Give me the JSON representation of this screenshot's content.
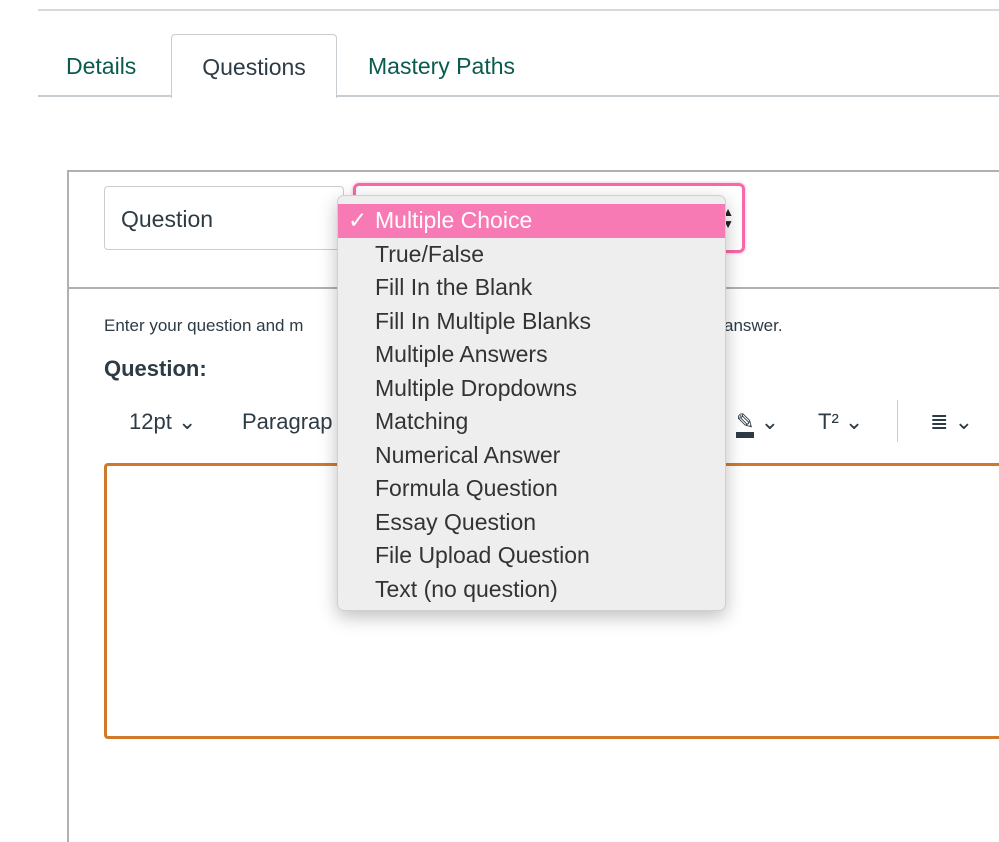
{
  "tabs": [
    {
      "label": "Details"
    },
    {
      "label": "Questions"
    },
    {
      "label": "Mastery Paths"
    }
  ],
  "active_tab": "Questions",
  "question_name": {
    "value": "Question"
  },
  "question_type": {
    "selected": "Multiple Choice",
    "options": [
      "Multiple Choice",
      "True/False",
      "Fill In the Blank",
      "Fill In Multiple Blanks",
      "Multiple Answers",
      "Multiple Dropdowns",
      "Matching",
      "Numerical Answer",
      "Formula Question",
      "Essay Question",
      "File Upload Question",
      "Text (no question)"
    ]
  },
  "help_left": "Enter your question and m",
  "help_right": "answer.",
  "question_label": "Question:",
  "toolbar": {
    "font_size": "12pt",
    "block": "Paragrap",
    "superscript": "T²"
  },
  "colors": {
    "accent": "#0a5a4f",
    "highlight": "#f87ab5",
    "focus": "#d0792a"
  }
}
